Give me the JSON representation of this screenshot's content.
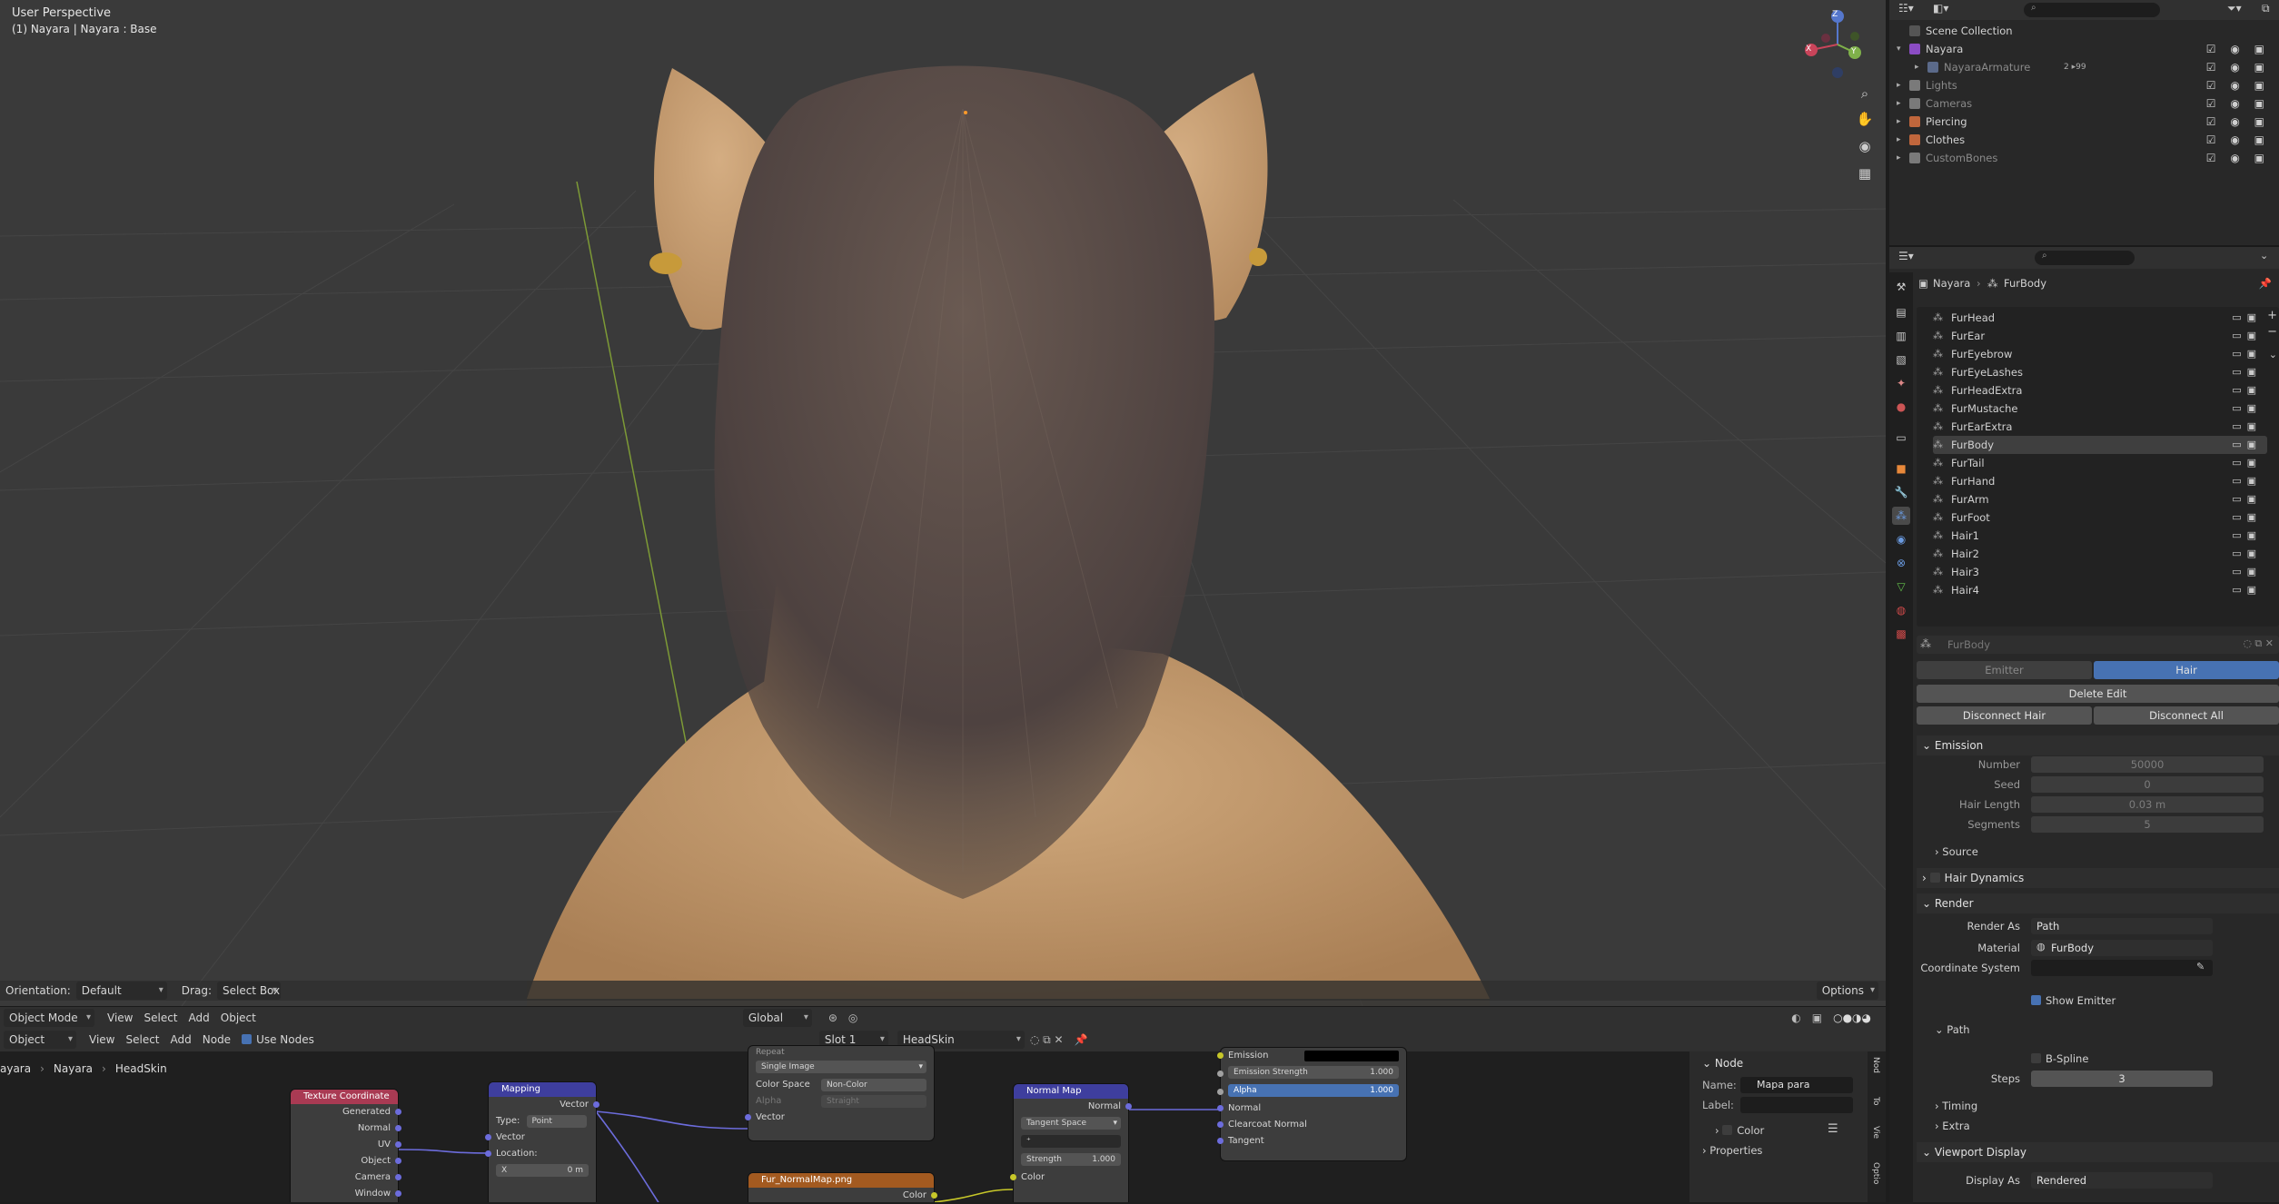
{
  "viewport": {
    "title": "User Perspective",
    "subtitle": "(1) Nayara | Nayara : Base",
    "toolbar": {
      "orientation_label": "Orientation:",
      "orientation_value": "Default",
      "drag_label": "Drag:",
      "drag_value": "Select Box",
      "options_label": "Options"
    },
    "gizmo": {
      "x": "X",
      "y": "Y",
      "z": "Z"
    }
  },
  "header3d": {
    "mode": "Object Mode",
    "menus": [
      "View",
      "Select",
      "Add",
      "Object"
    ],
    "transform": "Global"
  },
  "node_editor": {
    "header": {
      "type": "Object",
      "menus": [
        "View",
        "Select",
        "Add",
        "Node"
      ],
      "use_nodes": "Use Nodes",
      "slot": "Slot 1",
      "material": "HeadSkin"
    },
    "breadcrumb": [
      "ayara",
      "Nayara",
      "HeadSkin"
    ],
    "nodes": {
      "texcoord": {
        "title": "Texture Coordinate",
        "outputs": [
          "Generated",
          "Normal",
          "UV",
          "Object",
          "Camera",
          "Window"
        ]
      },
      "mapping": {
        "title": "Mapping",
        "out": "Vector",
        "type_label": "Type:",
        "type_value": "Point",
        "in_vector": "Vector",
        "location": "Location:",
        "x": "X",
        "x_val": "0 m"
      },
      "image": {
        "repeat": "Repeat",
        "source": "Single Image",
        "colorspace_label": "Color Space",
        "colorspace": "Non-Color",
        "alpha_label": "Alpha",
        "alpha": "Straight",
        "vector": "Vector"
      },
      "image2": {
        "title": "Fur_NormalMap.png",
        "color": "Color"
      },
      "normalmap": {
        "title": "Normal Map",
        "out": "Normal",
        "space": "Tangent Space",
        "strength_label": "Strength",
        "strength": "1.000",
        "color": "Color"
      },
      "bsdf": {
        "emission": "Emission",
        "emission_strength": "Emission Strength",
        "emission_strength_val": "1.000",
        "alpha": "Alpha",
        "alpha_val": "1.000",
        "normal": "Normal",
        "clearcoat_normal": "Clearcoat Normal",
        "tangent": "Tangent"
      }
    },
    "npanel": {
      "section": "Node",
      "name_label": "Name:",
      "name_value": "Mapa para normais",
      "label_label": "Label:",
      "color": "Color",
      "properties": "Properties",
      "tabs": [
        "Nod",
        "To",
        "Vie",
        "Optio"
      ]
    }
  },
  "outliner": {
    "root": "Scene Collection",
    "items": [
      {
        "label": "Nayara",
        "level": 1,
        "color": "#8b4cc4"
      },
      {
        "label": "NayaraArmature",
        "level": 2,
        "color": "#5b6a8a",
        "dim": true,
        "extra": "2 ▸99"
      },
      {
        "label": "Lights",
        "level": 1,
        "color": "#7a7a7a",
        "dim": true
      },
      {
        "label": "Cameras",
        "level": 1,
        "color": "#7a7a7a",
        "dim": true
      },
      {
        "label": "Piercing",
        "level": 1,
        "color": "#c0663c"
      },
      {
        "label": "Clothes",
        "level": 1,
        "color": "#c0663c"
      },
      {
        "label": "CustomBones",
        "level": 1,
        "color": "#7a7a7a",
        "dim": true
      }
    ]
  },
  "properties": {
    "breadcrumb": [
      "Nayara",
      "FurBody"
    ],
    "systems": [
      "FurHead",
      "FurEar",
      "FurEyebrow",
      "FurEyeLashes",
      "FurHeadExtra",
      "FurMustache",
      "FurEarExtra",
      "FurBody",
      "FurTail",
      "FurHand",
      "FurArm",
      "FurFoot",
      "Hair1",
      "Hair2",
      "Hair3",
      "Hair4"
    ],
    "selected": "FurBody",
    "settings_name": "FurBody",
    "type_emitter": "Emitter",
    "type_hair": "Hair",
    "delete_edit": "Delete Edit",
    "disconnect_hair": "Disconnect Hair",
    "disconnect_all": "Disconnect All",
    "emission": {
      "title": "Emission",
      "number_label": "Number",
      "number": "50000",
      "seed_label": "Seed",
      "seed": "0",
      "hair_length_label": "Hair Length",
      "hair_length": "0.03 m",
      "segments_label": "Segments",
      "segments": "5"
    },
    "source": "Source",
    "hair_dynamics": "Hair Dynamics",
    "render": {
      "title": "Render",
      "render_as_label": "Render As",
      "render_as": "Path",
      "material_label": "Material",
      "material": "FurBody",
      "coord_label": "Coordinate System",
      "show_emitter": "Show Emitter"
    },
    "path": {
      "title": "Path",
      "bspline": "B-Spline",
      "steps_label": "Steps",
      "steps": "3"
    },
    "timing": "Timing",
    "extra": "Extra",
    "viewport_display": {
      "title": "Viewport Display",
      "display_as_label": "Display As",
      "display_as": "Rendered"
    }
  },
  "colors": {
    "accent": "#4772b3",
    "viewport_bg": "#3a3a3a",
    "skin": "#c29a6d",
    "hair": "#5c4c44"
  }
}
